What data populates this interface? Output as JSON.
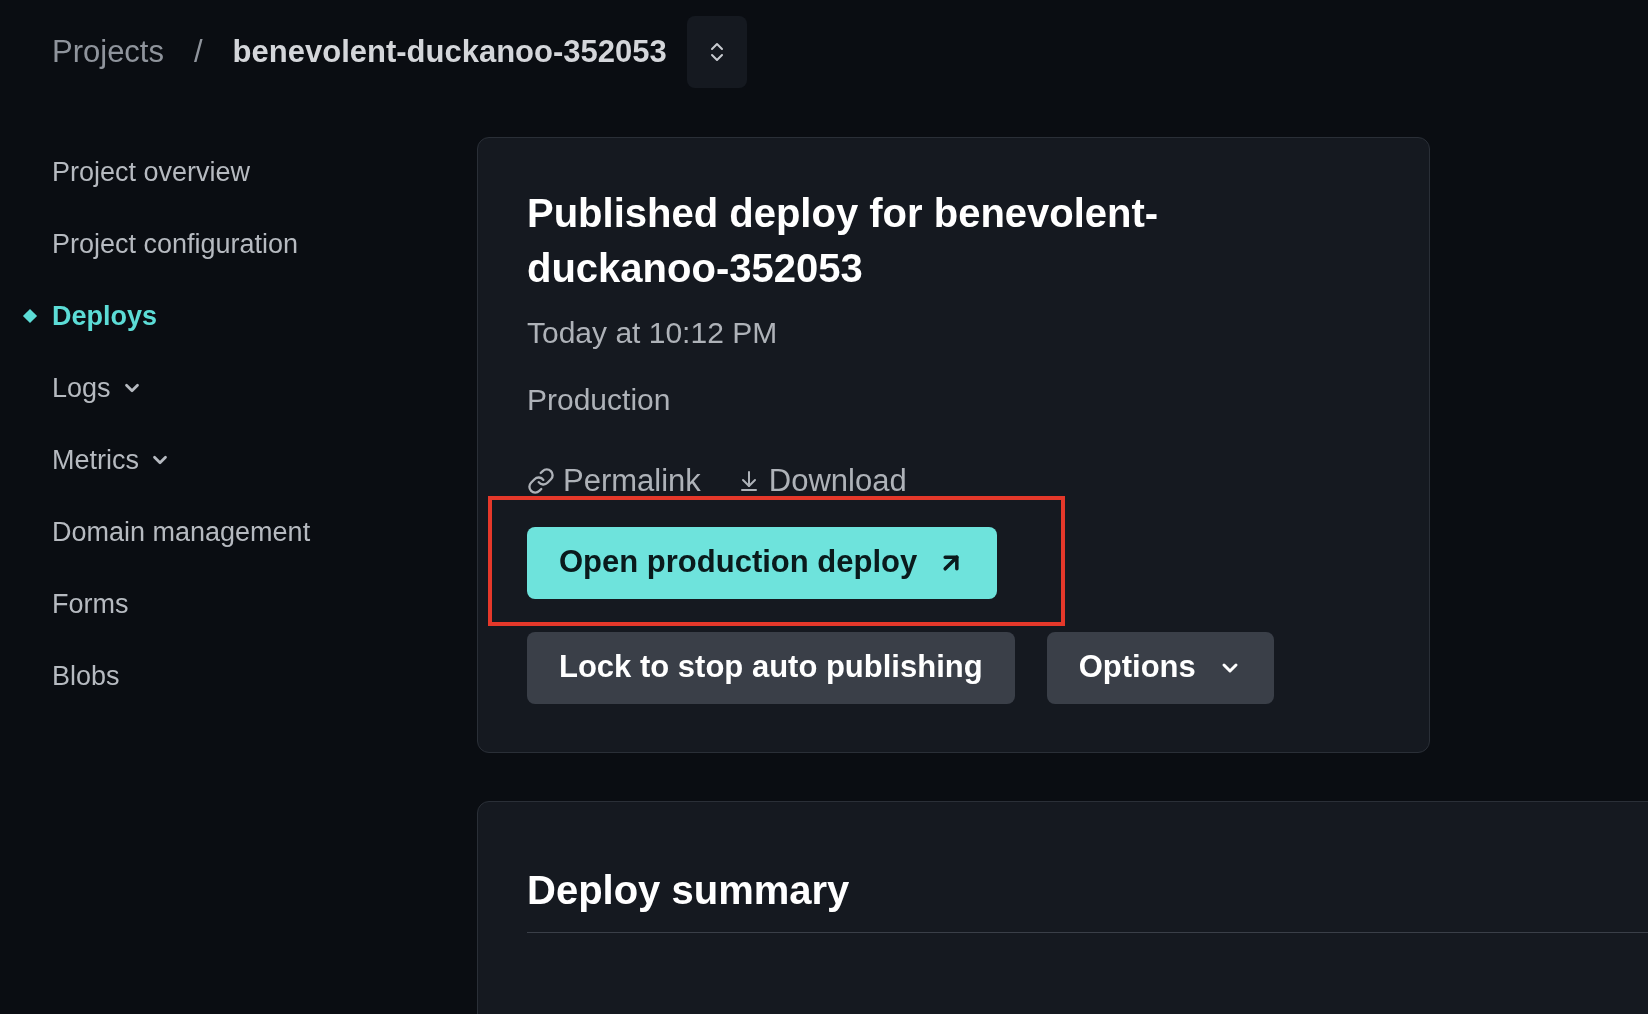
{
  "breadcrumb": {
    "root": "Projects",
    "separator": "/",
    "project": "benevolent-duckanoo-352053"
  },
  "sidebar": {
    "items": [
      {
        "label": "Project overview",
        "kind": "plain",
        "selected": false
      },
      {
        "label": "Project configuration",
        "kind": "plain",
        "selected": false
      },
      {
        "label": "Deploys",
        "kind": "plain",
        "selected": true
      },
      {
        "label": "Logs",
        "kind": "dropdown",
        "selected": false
      },
      {
        "label": "Metrics",
        "kind": "dropdown",
        "selected": false
      },
      {
        "label": "Domain management",
        "kind": "plain",
        "selected": false
      },
      {
        "label": "Forms",
        "kind": "plain",
        "selected": false
      },
      {
        "label": "Blobs",
        "kind": "plain",
        "selected": false
      }
    ]
  },
  "deploy_card": {
    "title": "Published deploy for benevolent-duckanoo-352053",
    "time": "Today at 10:12 PM",
    "context": "Production",
    "links": [
      {
        "label": "Permalink",
        "kind": "link"
      },
      {
        "label": "Download",
        "kind": "download"
      }
    ],
    "primary_button": {
      "label": "Open production deploy",
      "highlighted": true
    },
    "buttons": [
      {
        "label": "Lock to stop auto publishing",
        "kind": "plain"
      },
      {
        "label": "Options",
        "kind": "dropdown"
      }
    ]
  },
  "summary_card": {
    "title": "Deploy summary"
  }
}
